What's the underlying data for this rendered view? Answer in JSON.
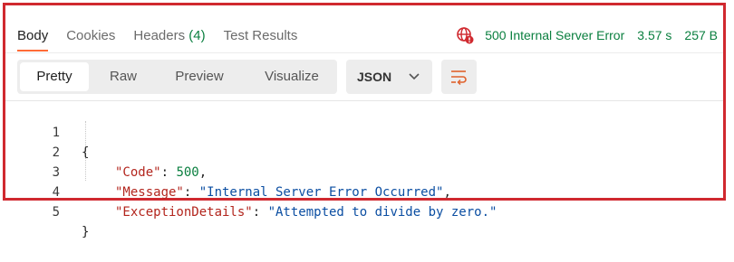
{
  "tabs": [
    {
      "label": "Body"
    },
    {
      "label": "Cookies"
    },
    {
      "label": "Headers",
      "count": "(4)"
    },
    {
      "label": "Test Results"
    }
  ],
  "status": {
    "code_text": "500 Internal Server Error",
    "time": "3.57 s",
    "size": "257 B",
    "color": "#0a7f3f",
    "icon": "globe-error-icon"
  },
  "view_modes": [
    {
      "label": "Pretty"
    },
    {
      "label": "Raw"
    },
    {
      "label": "Preview"
    },
    {
      "label": "Visualize"
    }
  ],
  "format_select": {
    "value": "JSON"
  },
  "code_lines": [
    {
      "num": "1",
      "open": "{"
    },
    {
      "num": "2",
      "key": "\"Code\"",
      "colon": ": ",
      "value": "500",
      "comma": ","
    },
    {
      "num": "3",
      "key": "\"Message\"",
      "colon": ": ",
      "value": "\"Internal Server Error Occurred\"",
      "comma": ","
    },
    {
      "num": "4",
      "key": "\"ExceptionDetails\"",
      "colon": ": ",
      "value": "\"Attempted to divide by zero.\"",
      "comma": ""
    },
    {
      "num": "5",
      "close": "}"
    }
  ],
  "colors": {
    "accent": "#ff6c37",
    "border": "#d0292f",
    "key": "#b3261e",
    "string": "#0b4ea2",
    "number": "#0a7f3f"
  }
}
